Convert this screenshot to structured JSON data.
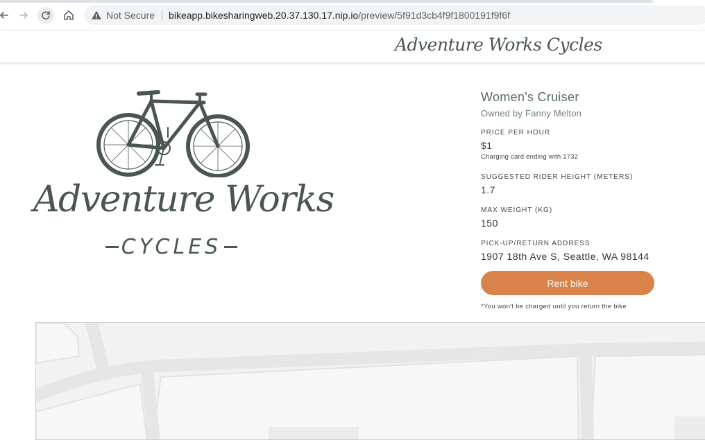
{
  "browser": {
    "security_label": "Not Secure",
    "url_host": "bikeapp.bikesharingweb.20.37.130.17.nip.io",
    "url_path": "/preview/5f91d3cb4f9f1800191f9f6f"
  },
  "header": {
    "logo_text": "Adventure Works Cycles"
  },
  "logo": {
    "script_text": "Adventure Works",
    "sub_text": "CYCLES"
  },
  "bike": {
    "name": "Women's Cruiser",
    "owner": "Owned by Fanny Melton",
    "price": {
      "label": "PRICE PER HOUR",
      "value": "$1",
      "note": "Charging card ending with 1732"
    },
    "rider_height": {
      "label": "SUGGESTED RIDER HEIGHT (METERS)",
      "value": "1.7"
    },
    "max_weight": {
      "label": "MAX WEIGHT (KG)",
      "value": "150"
    },
    "address": {
      "label": "PICK-UP/RETURN ADDRESS",
      "value": "1907 18th Ave S, Seattle, WA 98144"
    }
  },
  "actions": {
    "rent_label": "Rent bike",
    "rent_note": "*You won't be charged until you return the bike"
  },
  "colors": {
    "accent": "#d9824a",
    "brand": "#4a5650",
    "text": "#3e4a45"
  }
}
